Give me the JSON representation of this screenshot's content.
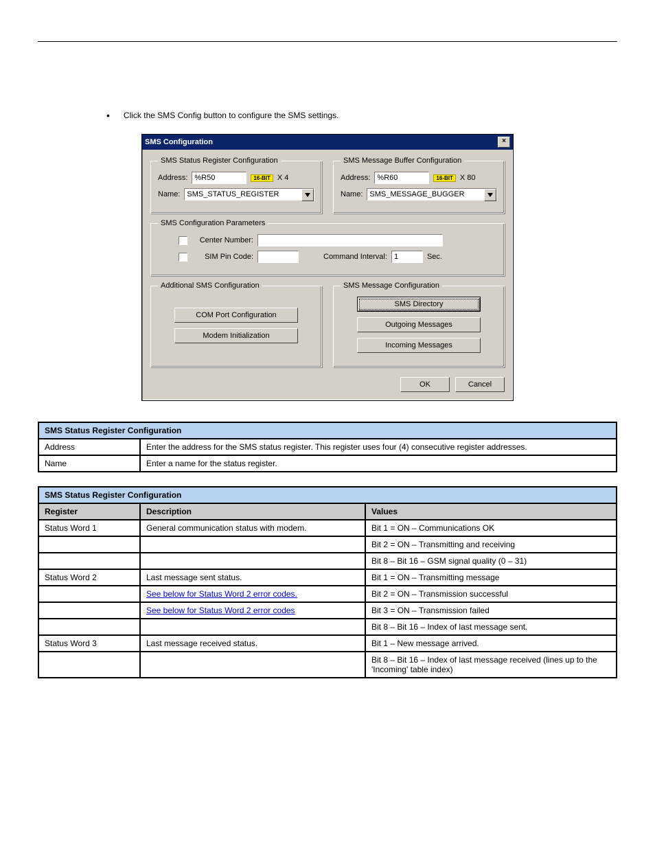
{
  "intro_bullet": "Click the SMS Config button to configure the SMS settings.",
  "dialog": {
    "title": "SMS Configuration",
    "close_glyph": "×",
    "status_group": {
      "legend": "SMS Status Register Configuration",
      "address_label": "Address:",
      "address_value": "%R50",
      "bit_badge": "16-BIT",
      "mult": "X 4",
      "name_label": "Name:",
      "name_value": "SMS_STATUS_REGISTER"
    },
    "buffer_group": {
      "legend": "SMS Message Buffer Configuration",
      "address_label": "Address:",
      "address_value": "%R60",
      "bit_badge": "16-BIT",
      "mult": "X 80",
      "name_label": "Name:",
      "name_value": "SMS_MESSAGE_BUGGER"
    },
    "params_group": {
      "legend": "SMS Configuration Parameters",
      "center_label": "Center Number:",
      "center_value": "",
      "pin_label": "SIM Pin Code:",
      "pin_value": "",
      "interval_label": "Command Interval:",
      "interval_value": "1",
      "interval_unit": "Sec."
    },
    "additional_group": {
      "legend": "Additional SMS Configuration",
      "btn_com": "COM Port Configuration",
      "btn_modem": "Modem Initialization"
    },
    "msgcfg_group": {
      "legend": "SMS Message Configuration",
      "btn_dir": "SMS Directory",
      "btn_out": "Outgoing Messages",
      "btn_in": "Incoming Messages"
    },
    "ok": "OK",
    "cancel": "Cancel"
  },
  "table1": {
    "header": "SMS Status Register Configuration",
    "rows": [
      {
        "c0": "Address",
        "c1": "Enter the address for the SMS status register. This register uses four (4) consecutive register addresses."
      },
      {
        "c0": "Name",
        "c1": "Enter a name for the status register."
      }
    ]
  },
  "table2": {
    "header": "SMS Status Register Configuration",
    "sub0": "Register",
    "sub1": "Description",
    "sub2": "Values",
    "rows": [
      {
        "c0": "Status Word 1",
        "c1": "General communication status with modem.",
        "c2": "Bit 1 = ON – Communications OK"
      },
      {
        "c0": "",
        "c1": "",
        "c2": "Bit 2 = ON – Transmitting and receiving"
      },
      {
        "c0": "",
        "c1": "",
        "c2": "Bit 8 – Bit 16 – GSM signal quality (0 – 31)"
      },
      {
        "c0": "Status Word 2",
        "c1": "Last message sent status.",
        "c2": "Bit 1 = ON – Transmitting message"
      },
      {
        "c0": "",
        "c1": "See below for Status Word 2 error codes.",
        "c2": "Bit 2 = ON – Transmission successful"
      },
      {
        "c0": "",
        "c1": "See below for Status Word 2 error codes",
        "c2": "Bit 3 = ON – Transmission failed"
      },
      {
        "c0": "",
        "c1": "",
        "c2": "Bit 8 – Bit 16 – Index of last message sent."
      },
      {
        "c0": "Status Word 3",
        "c1": "Last message received status.",
        "c2": "Bit 1 – New message arrived."
      },
      {
        "c0": "",
        "c1": "",
        "c2": "Bit 8 – Bit 16 – Index of last message received (lines up to the 'Incoming' table index)"
      }
    ]
  }
}
